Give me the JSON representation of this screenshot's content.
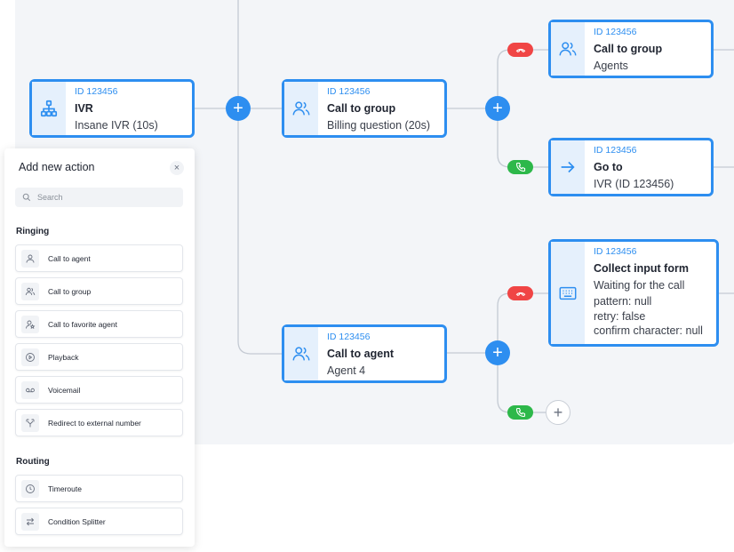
{
  "nodes": {
    "ivr": {
      "id": "ID 123456",
      "title": "IVR",
      "sub": "Insane IVR (10s)"
    },
    "group1": {
      "id": "ID 123456",
      "title": "Call to group",
      "sub": "Billing question (20s)"
    },
    "group2": {
      "id": "ID 123456",
      "title": "Call to group",
      "sub": "Agents"
    },
    "goto": {
      "id": "ID 123456",
      "title": "Go to",
      "sub": "IVR (ID 123456)"
    },
    "collect": {
      "id": "ID 123456",
      "title": "Collect input form",
      "lines": [
        "Waiting for the call",
        "pattern: null",
        "retry: false",
        "confirm character: null"
      ]
    },
    "agent": {
      "id": "ID 123456",
      "title": "Call to agent",
      "sub": "Agent 4"
    }
  },
  "glyphs": {
    "plus": "+",
    "close": "×"
  },
  "colors": {
    "accent": "#2d8ef0",
    "decline": "#f04545",
    "accept": "#2db84a"
  },
  "panel": {
    "title": "Add new action",
    "search_placeholder": "Search",
    "ringing_label": "Ringing",
    "routing_label": "Routing",
    "ringing_items": [
      {
        "label": "Call to agent",
        "icon": "user-icon"
      },
      {
        "label": "Call to group",
        "icon": "users-icon"
      },
      {
        "label": "Call to favorite agent",
        "icon": "favorite-agent-icon"
      },
      {
        "label": "Playback",
        "icon": "play-icon"
      },
      {
        "label": "Voicemail",
        "icon": "voicemail-icon"
      },
      {
        "label": "Redirect to external number",
        "icon": "redirect-icon"
      }
    ],
    "routing_items": [
      {
        "label": "Timeroute",
        "icon": "clock-icon"
      },
      {
        "label": "Condition Splitter",
        "icon": "splitter-icon"
      }
    ]
  }
}
